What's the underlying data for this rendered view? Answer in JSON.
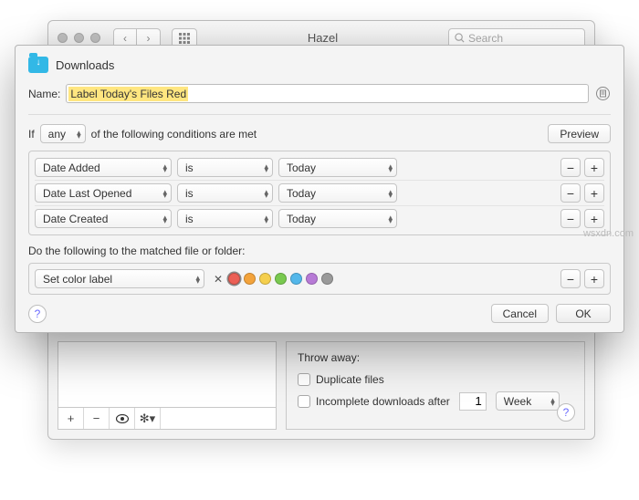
{
  "backwin": {
    "title": "Hazel",
    "search_placeholder": "Search"
  },
  "sheet": {
    "folder_name": "Downloads",
    "name_label": "Name:",
    "name_value": "Label Today's Files Red",
    "if_prefix": "If",
    "match_scope": "any",
    "if_suffix": "of the following conditions are met",
    "preview_label": "Preview",
    "conditions": [
      {
        "attr": "Date Added",
        "op": "is",
        "val": "Today"
      },
      {
        "attr": "Date Last Opened",
        "op": "is",
        "val": "Today"
      },
      {
        "attr": "Date Created",
        "op": "is",
        "val": "Today"
      }
    ],
    "do_label": "Do the following to the matched file or folder:",
    "action": "Set color label",
    "colors": {
      "red": "#ec5f55",
      "orange": "#f3a33b",
      "yellow": "#f5cf4d",
      "green": "#7ac e55",
      "cyan": "#53b7ea",
      "purple": "#b77ad6",
      "grey": "#9a9a9a"
    },
    "cancel_label": "Cancel",
    "ok_label": "OK"
  },
  "throw": {
    "header": "Throw away:",
    "dup_label": "Duplicate files",
    "incomplete_label": "Incomplete downloads after",
    "incomplete_value": "1",
    "incomplete_unit": "Week"
  },
  "watermark": "wsxdn.com"
}
